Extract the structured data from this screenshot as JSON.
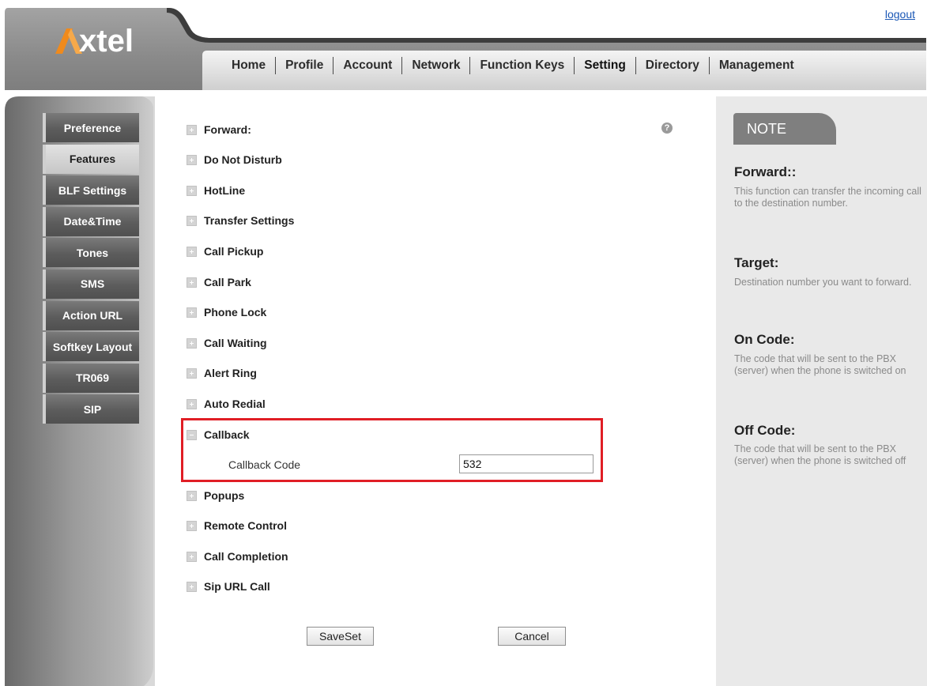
{
  "header": {
    "logout_label": "logout",
    "logo_text": "xtel",
    "nav": [
      "Home",
      "Profile",
      "Account",
      "Network",
      "Function Keys",
      "Setting",
      "Directory",
      "Management"
    ],
    "active_nav": "Setting"
  },
  "sidebar": {
    "items": [
      "Preference",
      "Features",
      "BLF Settings",
      "Date&Time",
      "Tones",
      "SMS",
      "Action URL",
      "Softkey Layout",
      "TR069",
      "SIP"
    ],
    "active": "Features"
  },
  "main": {
    "sections": [
      {
        "label": "Forward:",
        "expanded": false
      },
      {
        "label": "Do Not Disturb",
        "expanded": false
      },
      {
        "label": "HotLine",
        "expanded": false
      },
      {
        "label": "Transfer Settings",
        "expanded": false
      },
      {
        "label": "Call Pickup",
        "expanded": false
      },
      {
        "label": "Call Park",
        "expanded": false
      },
      {
        "label": "Phone Lock",
        "expanded": false
      },
      {
        "label": "Call Waiting",
        "expanded": false
      },
      {
        "label": "Alert Ring",
        "expanded": false
      },
      {
        "label": "Auto Redial",
        "expanded": false
      },
      {
        "label": "Callback",
        "expanded": true
      },
      {
        "label": "Popups",
        "expanded": false
      },
      {
        "label": "Remote Control",
        "expanded": false
      },
      {
        "label": "Call Completion",
        "expanded": false
      },
      {
        "label": "Sip URL Call",
        "expanded": false
      }
    ],
    "help_icon": "question-icon",
    "callback_code_label": "Callback Code",
    "callback_code_value": "532",
    "saveset_label": "SaveSet",
    "cancel_label": "Cancel"
  },
  "note": {
    "tab_label": "NOTE",
    "entries": [
      {
        "title": "Forward::",
        "text": "This function can transfer the incoming call to the destination number."
      },
      {
        "title": "Target:",
        "text": "Destination number you want to forward."
      },
      {
        "title": "On Code:",
        "text": "The code that will be sent to the PBX (server) when the phone is switched on"
      },
      {
        "title": "Off Code:",
        "text": "The code that will be sent to the PBX (server) when the phone is switched off"
      }
    ]
  },
  "colors": {
    "header_gray": "#8c8c8c",
    "logo_orange": "#f08a1c",
    "highlight_red": "#e01e25",
    "link_blue": "#1a57b5"
  }
}
